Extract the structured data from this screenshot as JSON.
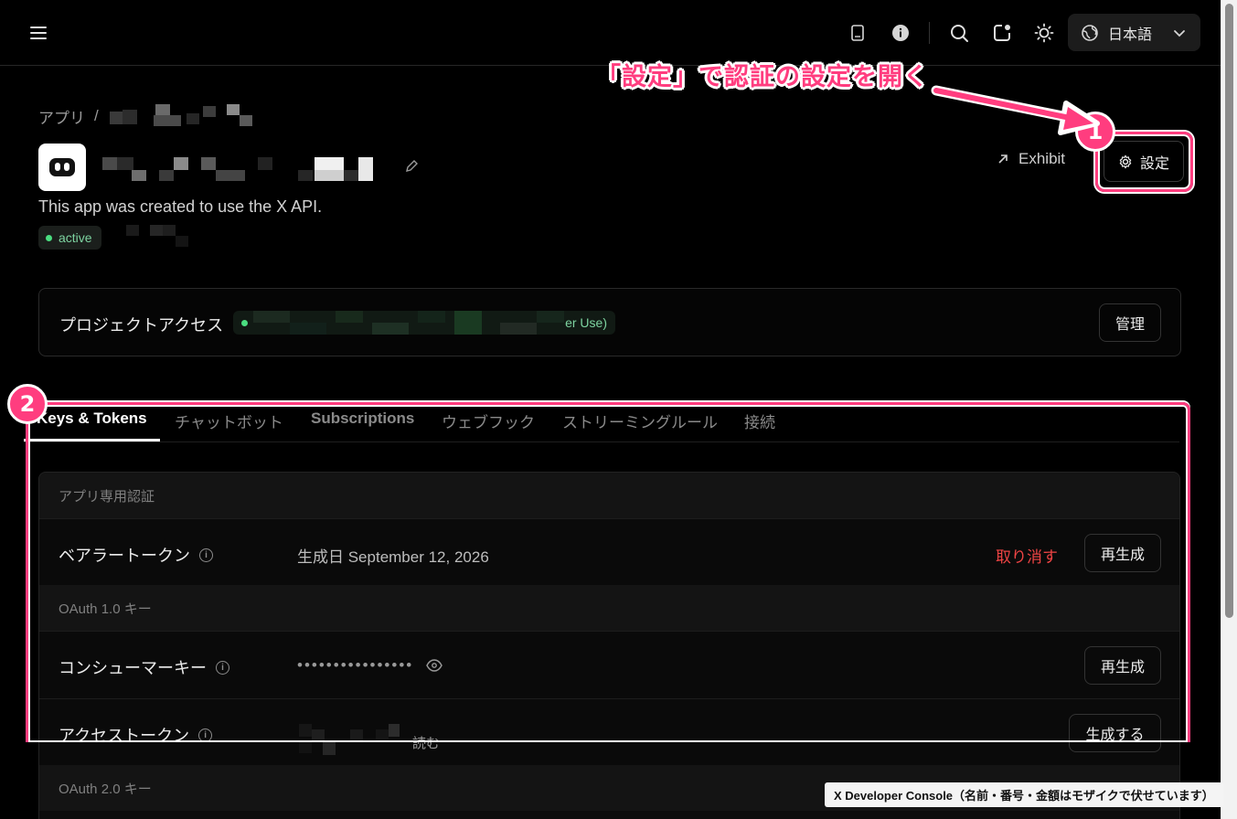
{
  "topbar": {
    "language_label": "日本語"
  },
  "breadcrumb": {
    "root": "アプリ",
    "separator": "/"
  },
  "app": {
    "description": "This app was created to use the X API.",
    "status": "active",
    "exhibit_label": "Exhibit",
    "settings_label": "設定"
  },
  "project": {
    "title": "プロジェクトアクセス",
    "pill_tail": "er Use)",
    "manage_label": "管理"
  },
  "tabs": [
    {
      "label": "Keys & Tokens",
      "active": true
    },
    {
      "label": "チャットボット",
      "active": false
    },
    {
      "label": "Subscriptions",
      "active": false
    },
    {
      "label": "ウェブフック",
      "active": false
    },
    {
      "label": "ストリーミングルール",
      "active": false
    },
    {
      "label": "接続",
      "active": false
    }
  ],
  "keys": {
    "section_app_auth": "アプリ専用認証",
    "bearer_label": "ベアラートークン",
    "bearer_value": "生成日 September 12, 2026",
    "bearer_revoke": "取り消す",
    "bearer_regen": "再生成",
    "section_oauth1": "OAuth 1.0 キー",
    "consumer_label": "コンシューマーキー",
    "consumer_value": "••••••••••••••••",
    "consumer_regen": "再生成",
    "access_label": "アクセストークン",
    "access_perm": "読む",
    "access_generate": "生成する",
    "section_oauth2": "OAuth 2.0 キー"
  },
  "annotations": {
    "callout": "「設定」で認証の設定を開く",
    "badge1": "1",
    "badge2": "2",
    "highlight_color": "#ff3d7f",
    "caption": "X Developer Console（名前・番号・金額はモザイクで伏せています）"
  },
  "colors": {
    "background": "#000000",
    "active_green": "#4ade80",
    "danger_red": "#ef4444"
  }
}
